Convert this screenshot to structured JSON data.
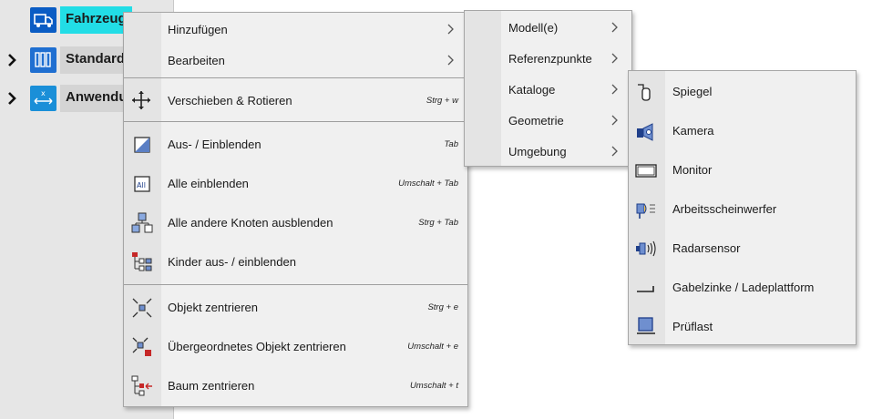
{
  "tree": {
    "items": [
      {
        "label": "Fahrzeug",
        "icon": "truck-icon",
        "color": "#0a5cc4",
        "highlight": "#22dde6"
      },
      {
        "label": "Standard",
        "icon": "binders-icon",
        "color": "#1f6fd1"
      },
      {
        "label": "Anwendu",
        "icon": "axis-arrows-icon",
        "color": "#1a8fd8"
      }
    ]
  },
  "menu1": {
    "items": [
      {
        "label": "Hinzufügen",
        "submenu": true
      },
      {
        "label": "Bearbeiten",
        "submenu": true
      },
      {
        "label": "Verschieben & Rotieren",
        "shortcut": "Strg + w",
        "icon": "move-icon"
      },
      {
        "label": "Aus- / Einblenden",
        "shortcut": "Tab",
        "icon": "toggle-visibility-icon"
      },
      {
        "label": "Alle einblenden",
        "shortcut": "Umschalt + Tab",
        "icon": "show-all-icon"
      },
      {
        "label": "Alle andere Knoten ausblenden",
        "shortcut": "Strg + Tab",
        "icon": "hide-other-nodes-icon"
      },
      {
        "label": "Kinder aus- / einblenden",
        "shortcut": "",
        "icon": "children-toggle-icon"
      },
      {
        "label": "Objekt zentrieren",
        "shortcut": "Strg + e",
        "icon": "center-object-icon"
      },
      {
        "label": "Übergeordnetes Objekt zentrieren",
        "shortcut": "Umschalt + e",
        "icon": "center-parent-icon"
      },
      {
        "label": "Baum zentrieren",
        "shortcut": "Umschalt + t",
        "icon": "center-tree-icon"
      }
    ]
  },
  "menu2": {
    "items": [
      {
        "label": "Modell(e)"
      },
      {
        "label": "Referenzpunkte"
      },
      {
        "label": "Kataloge"
      },
      {
        "label": "Geometrie"
      },
      {
        "label": "Umgebung"
      }
    ]
  },
  "menu3": {
    "items": [
      {
        "label": "Spiegel",
        "icon": "mirror-icon"
      },
      {
        "label": "Kamera",
        "icon": "camera-icon"
      },
      {
        "label": "Monitor",
        "icon": "monitor-icon"
      },
      {
        "label": "Arbeitsscheinwerfer",
        "icon": "work-light-icon"
      },
      {
        "label": "Radarsensor",
        "icon": "radar-sensor-icon"
      },
      {
        "label": "Gabelzinke / Ladeplattform",
        "icon": "fork-platform-icon"
      },
      {
        "label": "Prüflast",
        "icon": "test-load-icon"
      }
    ]
  }
}
